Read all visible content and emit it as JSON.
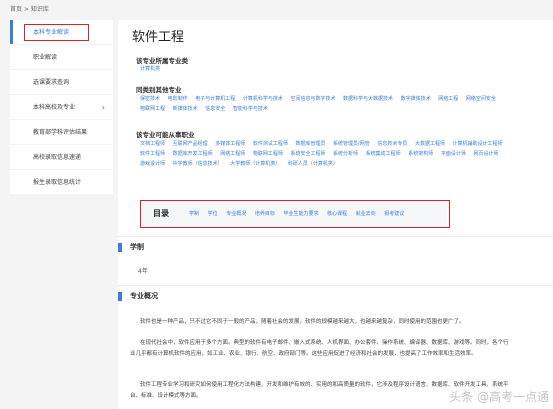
{
  "breadcrumb": "首页 > 知识库",
  "sidebar": {
    "items": [
      {
        "label": "本科专业解读"
      },
      {
        "label": "职业解读"
      },
      {
        "label": "选课要求查询"
      },
      {
        "label": "本科高校及专业"
      },
      {
        "label": "教育部学科评估结果"
      },
      {
        "label": "高校录取信息速递"
      },
      {
        "label": "报生录取信息统计"
      }
    ],
    "chevron": "›"
  },
  "title": "软件工程",
  "category": {
    "heading": "该专业所属专业类",
    "links": [
      "计算机类"
    ]
  },
  "peers": {
    "heading": "同类别其他专业",
    "links": [
      "保密技术",
      "电影制作",
      "电子与计算机工程",
      "计算机科学与技术",
      "空间信息与数字技术",
      "数据科学与大数据技术",
      "数字媒体技术",
      "网络工程",
      "网络空间安全",
      "物联网工程",
      "新媒体技术",
      "信息安全",
      "智能科学与技术"
    ]
  },
  "careers": {
    "heading": "该专业可能从事职业",
    "links": [
      "文档工程师",
      "互联网产品经理",
      "多媒体工程师",
      "软件测试工程师",
      "数据库管理员",
      "系统管理员/网管",
      "信息技术专员",
      "大数据工程师",
      "计算机辅助设计工程师",
      "软件工程师",
      "数据库开发工程师",
      "网络工程师",
      "物联网工程师",
      "系统安全工程师",
      "系统分析师",
      "系统集成工程师",
      "系统架构师",
      "平面设计师",
      "网页设计师",
      "游戏设计师",
      "中学教师（信息技术）",
      "大学教师（计算机类）",
      "科研人员（计算机类）"
    ]
  },
  "toc": {
    "label": "目录",
    "links": [
      "学制",
      "学位",
      "专业概况",
      "培养目标",
      "毕业生能力要求",
      "核心课程",
      "就业去向",
      "报考建议"
    ]
  },
  "xuezhi": {
    "heading": "学制",
    "value": "4年"
  },
  "overview": {
    "heading": "专业概况",
    "paragraphs": [
      "软件也是一种产品，只不过它不同于一般的产品，随着社会的发展，软件的规模越来越大，也越来越复杂，同时使用的范围也更广了。",
      "在现代社会中，软件应用于多个方面。典型的软件有电子邮件、嵌入式系统、人机界面、办公套件、操作系统、编译器、数据库、游戏等。同时，各个行业几乎都有计算机软件的应用，如工业、农业、银行、航空、政府部门等。这些应用促进了经济和社会的发展，也提高了工作效率和生活效率。",
      "软件工程专业学习和研究如何使用工程化方法构建、开发和维护有效的、实用的和高质量的软件，它涉及程序设计语言、数据库、软件开发工具、系统平台、标准、设计模式等方面。"
    ]
  },
  "watermark": "头条 @高考一点通"
}
